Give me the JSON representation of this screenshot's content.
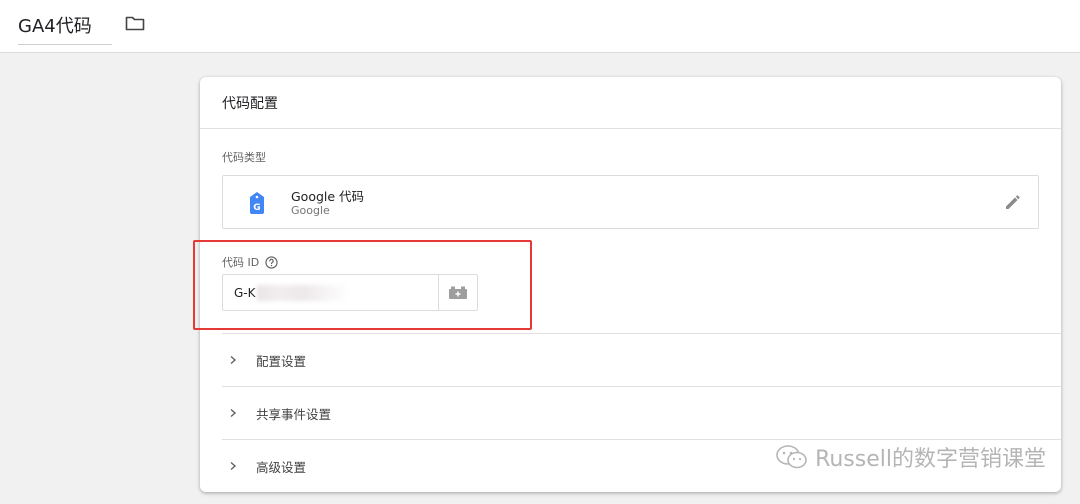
{
  "header": {
    "tag_name": "GA4代码"
  },
  "card": {
    "title": "代码配置",
    "tag_type_label": "代码类型",
    "tag_type": {
      "name": "Google 代码",
      "vendor": "Google"
    },
    "tag_id_label": "代码 ID",
    "tag_id_value": "G-K",
    "sections": [
      {
        "label": "配置设置"
      },
      {
        "label": "共享事件设置"
      },
      {
        "label": "高级设置"
      }
    ]
  },
  "watermark": {
    "text": "Russell的数字营销课堂"
  },
  "colors": {
    "highlight": "#e53935",
    "google_blue": "#4285f4"
  }
}
